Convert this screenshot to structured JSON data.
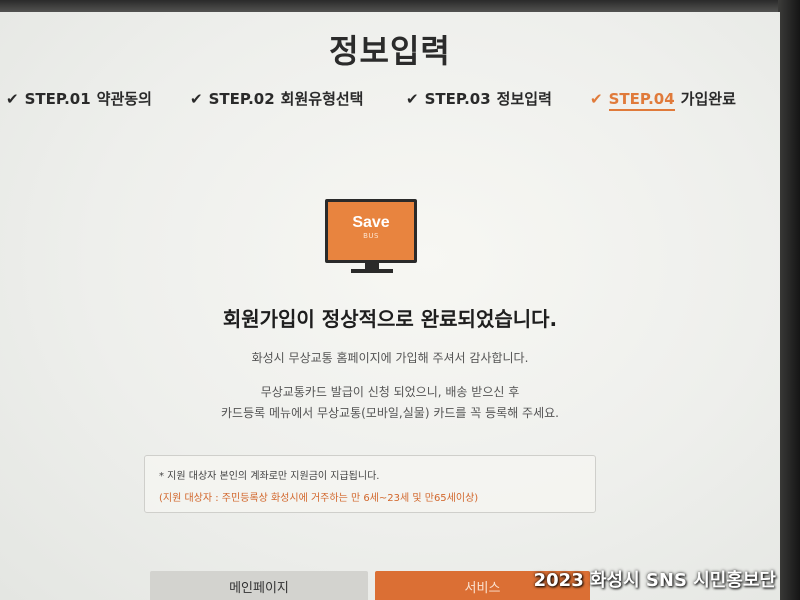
{
  "page": {
    "title": "정보입력"
  },
  "steps": [
    {
      "code": "STEP.01",
      "label": "약관동의",
      "status": "done"
    },
    {
      "code": "STEP.02",
      "label": "회원유형선택",
      "status": "done"
    },
    {
      "code": "STEP.03",
      "label": "정보입력",
      "status": "done"
    },
    {
      "code": "STEP.04",
      "label": "가입완료",
      "status": "active"
    }
  ],
  "check_glyph": "✔",
  "logo": {
    "text": "Save",
    "subtext": "BUS",
    "color": "#e8843f",
    "icon": "monitor-icon"
  },
  "headline": "회원가입이 정상적으로 완료되었습니다.",
  "messages": [
    "화성시 무상교통 홈페이지에 가입해 주셔서 감사합니다.",
    "무상교통카드 발급이 신청 되었으니, 배송 받으신 후",
    "카드등록 메뉴에서 무상교통(모바일,실물) 카드를 꼭 등록해 주세요."
  ],
  "notice": {
    "line1": "* 지원 대상자 본인의 계좌로만 지원금이 지급됩니다.",
    "line2": "(지원 대상자 : 주민등록상 화성시에 거주하는 만 6세~23세 및 만65세이상)"
  },
  "buttons": {
    "main_label": "메인페이지",
    "service_label": "서비스"
  },
  "colors": {
    "accent": "#e07a3a",
    "button_primary": "#db6f34",
    "button_secondary": "#d3d3cf"
  },
  "watermark": "2023 화성시 SNS 시민홍보단"
}
